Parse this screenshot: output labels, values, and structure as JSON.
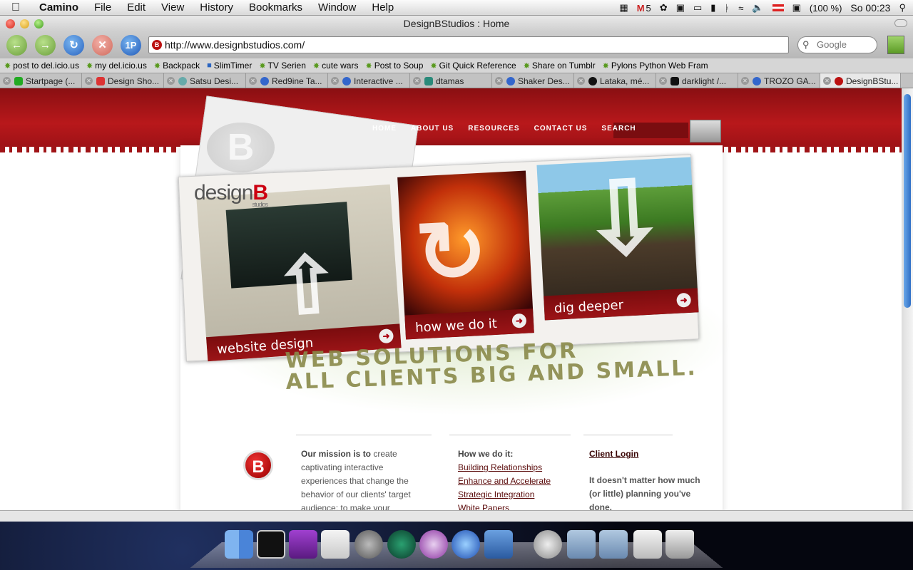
{
  "menubar": {
    "app": "Camino",
    "items": [
      "File",
      "Edit",
      "View",
      "History",
      "Bookmarks",
      "Window",
      "Help"
    ],
    "status": {
      "mail_count": "5",
      "battery": "(100 %)",
      "clock": "So 00:23"
    }
  },
  "window": {
    "title": "DesignBStudios : Home"
  },
  "toolbar": {
    "url": "http://www.designbstudios.com/",
    "search_placeholder": "Google",
    "onepassword": "1P"
  },
  "bookmarks": [
    "post to del.icio.us",
    "my del.icio.us",
    "Backpack",
    "SlimTimer",
    "TV Serien",
    "cute wars",
    "Post to Soup",
    "Git Quick Reference",
    "Share on Tumblr",
    "Pylons Python Web Fram"
  ],
  "tabs": [
    "Startpage (...",
    "Design Sho...",
    "Satsu Desi...",
    "Red9ine Ta...",
    "Interactive ...",
    "dtamas",
    "Shaker Des...",
    "Lataka, mé...",
    "darklight /...",
    "TROZO GA...",
    "DesignBStu..."
  ],
  "site": {
    "nav": [
      "HOME",
      "ABOUT US",
      "RESOURCES",
      "CONTACT US",
      "SEARCH"
    ],
    "logo": {
      "prefix": "design",
      "mark": "B",
      "sub": "studios"
    },
    "panels": [
      {
        "label": "website design"
      },
      {
        "label": "how we do it"
      },
      {
        "label": "dig deeper"
      }
    ],
    "headline": [
      "WEB SOLUTIONS FOR",
      "ALL CLIENTS BIG AND SMALL."
    ],
    "mission": {
      "bold": "Our mission is to",
      "text": " create captivating interactive experiences that change the behavior of our clients' target audience; to make your"
    },
    "how": {
      "heading": "How we do it:",
      "links": [
        "Building Relationships",
        "Enhance and Accelerate",
        "Strategic Integration",
        "White Papers"
      ]
    },
    "client": {
      "link": "Client Login",
      "text": "It doesn't matter how much (or little) planning you've done."
    }
  },
  "colors": {
    "brand_red": "#b8181b",
    "dark_red": "#7a0c0e",
    "headline": "#8a8a4a"
  }
}
